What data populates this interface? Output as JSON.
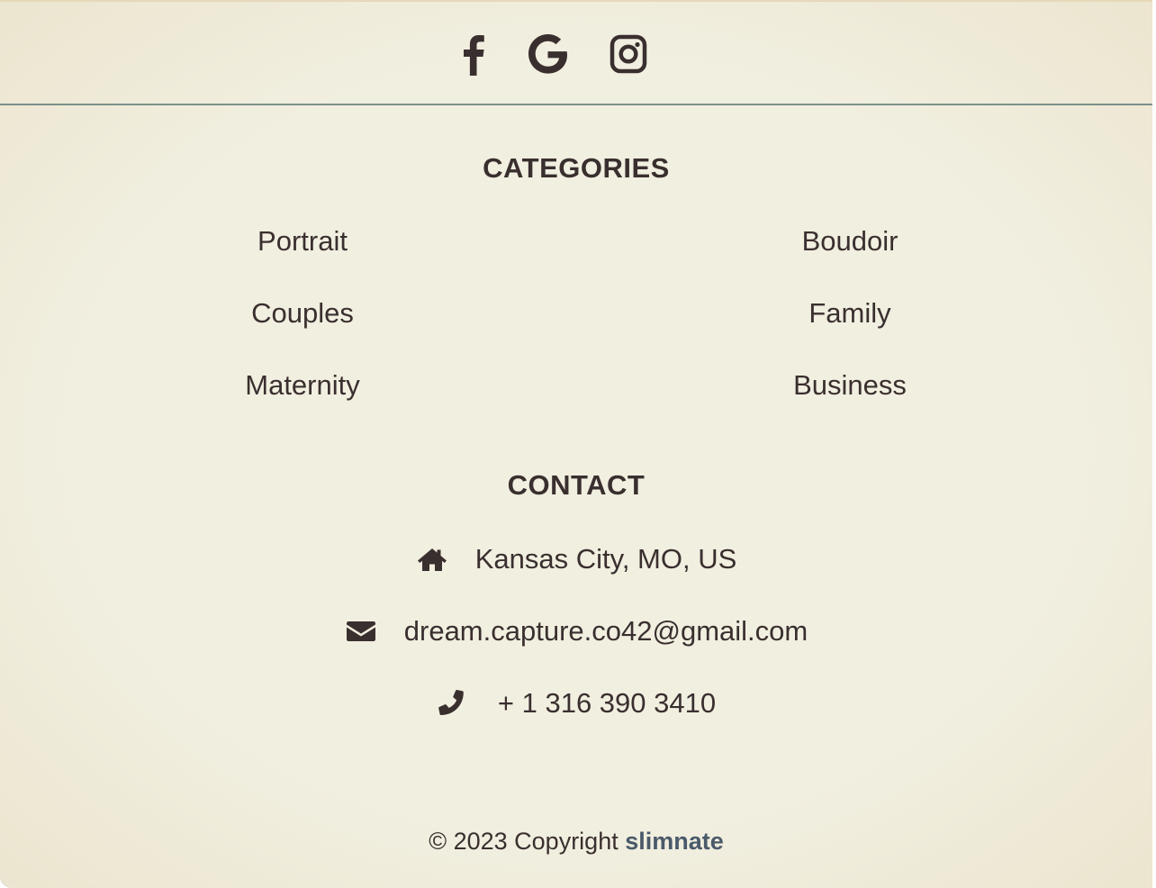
{
  "social": {
    "facebook_icon": "facebook-icon",
    "google_icon": "google-icon",
    "instagram_icon": "instagram-icon"
  },
  "categories": {
    "title": "CATEGORIES",
    "left": [
      "Portrait",
      "Couples",
      "Maternity"
    ],
    "right": [
      "Boudoir",
      "Family",
      "Business"
    ]
  },
  "contact": {
    "title": "CONTACT",
    "address": "Kansas City, MO, US",
    "email": "dream.capture.co42@gmail.com",
    "phone": "+ 1 316 390 3410",
    "address_icon": "home-icon",
    "email_icon": "envelope-icon",
    "phone_icon": "phone-icon"
  },
  "copyright": {
    "text": "© 2023 Copyright",
    "brand": "slimnate"
  },
  "colors": {
    "background": "#f1efe0",
    "text": "#3a2f2f",
    "divider": "#7d908a",
    "brand_link": "#4a5a6a"
  }
}
